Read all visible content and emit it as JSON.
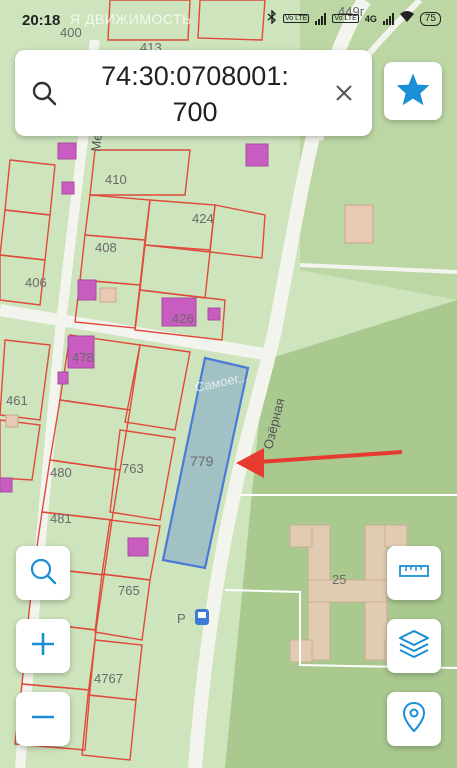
{
  "status_bar": {
    "time": "20:18",
    "watermark": "Я      ДВИЖИМОСТЬ",
    "network": "4G",
    "battery": "75",
    "volte_label": "Vo LTE"
  },
  "search": {
    "query_line1": "74:30:0708001:",
    "query_line2": "700"
  },
  "map": {
    "parcel_labels": [
      "400",
      "413",
      "449г",
      "410",
      "424",
      "408",
      "406",
      "426",
      "478",
      "461",
      "480",
      "763",
      "779",
      "481",
      "765",
      "4767",
      "25"
    ],
    "street_labels": [
      "Озёрная",
      "Ме"
    ],
    "watermark_text": "Самоег...",
    "highlighted_parcel": "779",
    "transit_stop_label": "P"
  },
  "colors": {
    "accent": "#1a8fd6",
    "parcel_outline": "#e04a3a",
    "selected_parcel": "#4a7ad8",
    "arrow": "#e63b2e"
  },
  "icons": {
    "search": "search-icon",
    "clear": "close-icon",
    "favorite": "star-icon",
    "zoom_search": "magnifier-icon",
    "zoom_in": "plus-icon",
    "zoom_out": "minus-icon",
    "ruler": "ruler-icon",
    "layers": "layers-icon",
    "location": "location-pin-icon"
  }
}
